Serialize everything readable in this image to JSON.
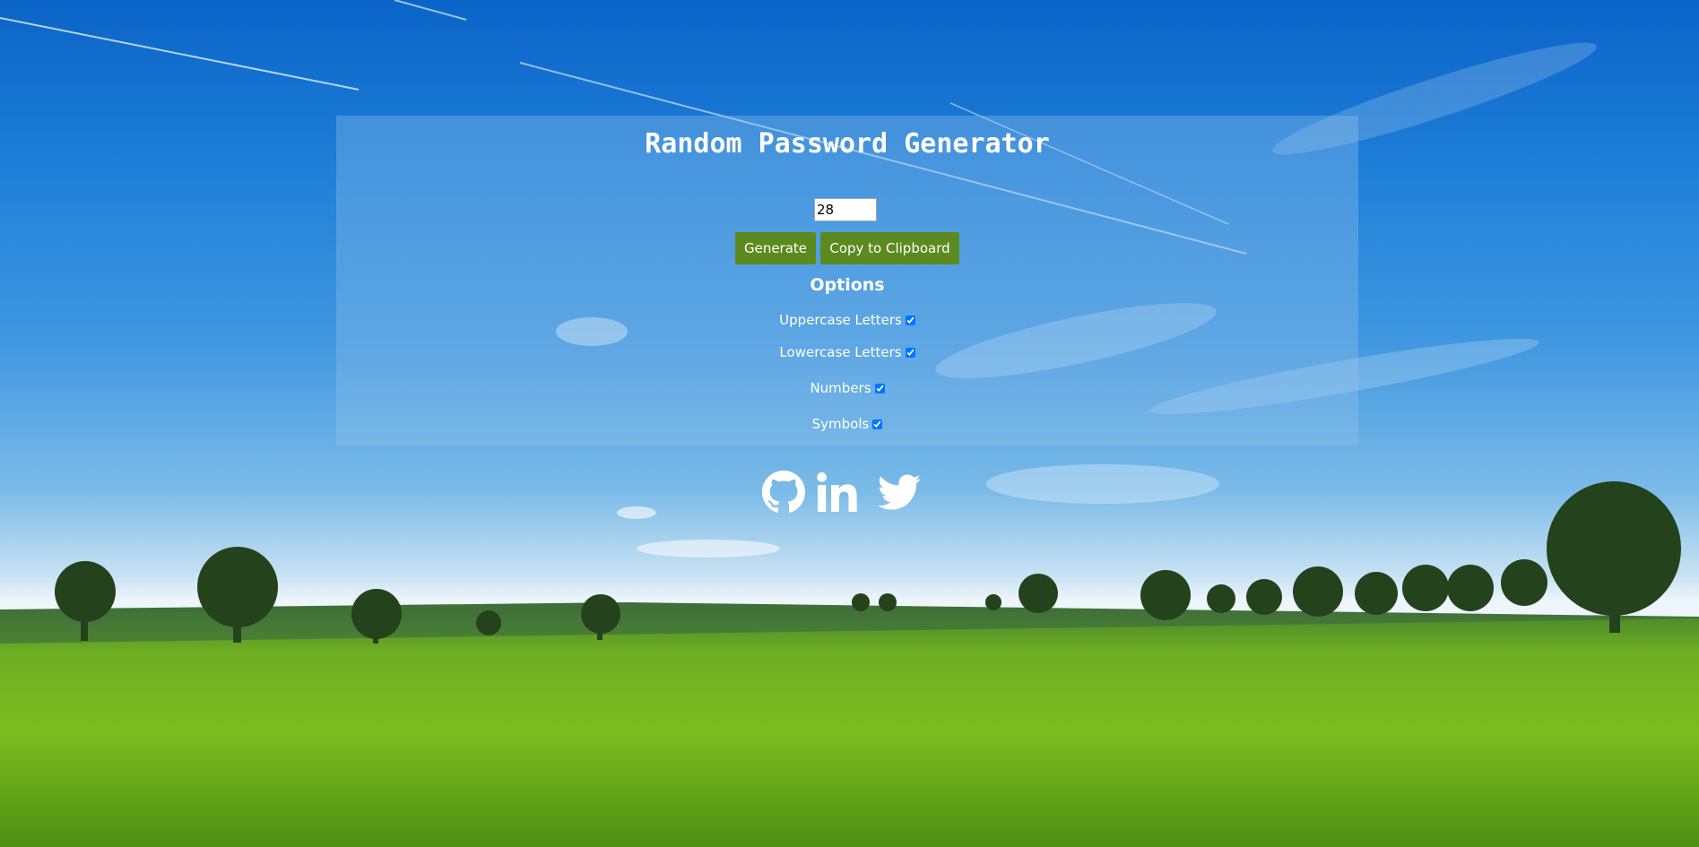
{
  "app": {
    "title": "Random Password Generator"
  },
  "controls": {
    "length_value": "28",
    "generate_label": "Generate",
    "copy_label": "Copy to Clipboard"
  },
  "options": {
    "heading": "Options",
    "items": [
      {
        "label": "Uppercase Letters",
        "checked": true
      },
      {
        "label": "Lowercase Letters",
        "checked": true
      },
      {
        "label": "Numbers",
        "checked": true
      },
      {
        "label": "Symbols",
        "checked": true
      }
    ]
  },
  "socials": {
    "icons": [
      "github-icon",
      "linkedin-icon",
      "twitter-icon"
    ]
  },
  "colors": {
    "button": "#5b8a1e",
    "text": "#ffffff",
    "panel": "rgba(150,195,235,0.35)"
  }
}
